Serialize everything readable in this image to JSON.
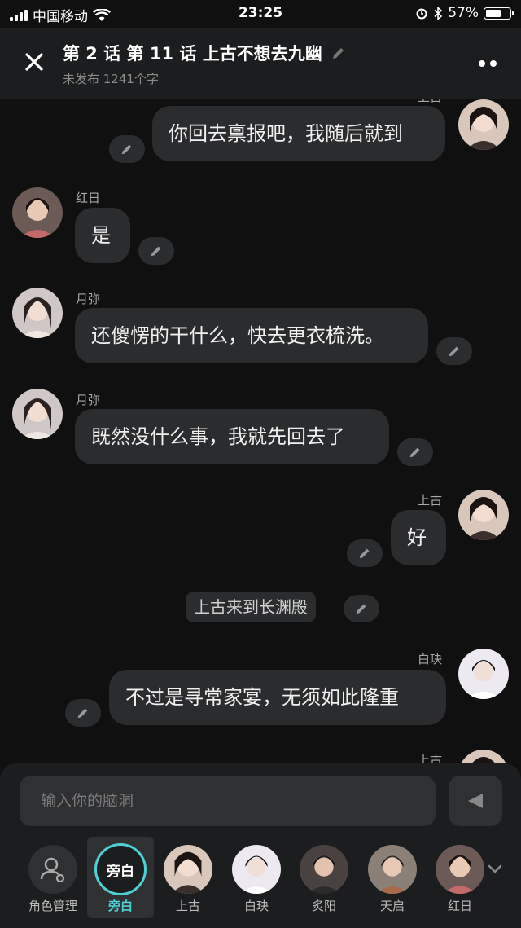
{
  "status": {
    "carrier": "中国移动",
    "time": "23:25",
    "battery": "57%",
    "battery_level": 0.57
  },
  "header": {
    "title": "第 2 话  第 11 话  上古不想去九幽",
    "subtitle": "未发布 1241个字"
  },
  "messages": [
    {
      "side": "right",
      "name": "上古",
      "text": "你回去禀报吧，我随后就到"
    },
    {
      "side": "left",
      "name": "红日",
      "text": "是"
    },
    {
      "side": "left",
      "name": "月弥",
      "text": "还傻愣的干什么，快去更衣梳洗。"
    },
    {
      "side": "left",
      "name": "月弥",
      "text": "既然没什么事，我就先回去了"
    },
    {
      "side": "right",
      "name": "上古",
      "text": "好"
    },
    {
      "side": "narration",
      "text": "上古来到长渊殿"
    },
    {
      "side": "right",
      "name": "白玦",
      "text": "不过是寻常家宴，无须如此隆重"
    },
    {
      "side": "right",
      "name": "上古",
      "text": ""
    }
  ],
  "composer": {
    "placeholder": "输入你的脑洞"
  },
  "roles": [
    {
      "label": "角色管理",
      "icon": "role-manage-icon"
    },
    {
      "label": "旁白",
      "avatar_text": "旁白",
      "selected": true
    },
    {
      "label": "上古"
    },
    {
      "label": "白玦"
    },
    {
      "label": "炙阳"
    },
    {
      "label": "天启"
    },
    {
      "label": "红日"
    }
  ],
  "colors": {
    "accent": "#4fd0d4",
    "bubble": "#2b2c2e",
    "background": "#101010"
  }
}
